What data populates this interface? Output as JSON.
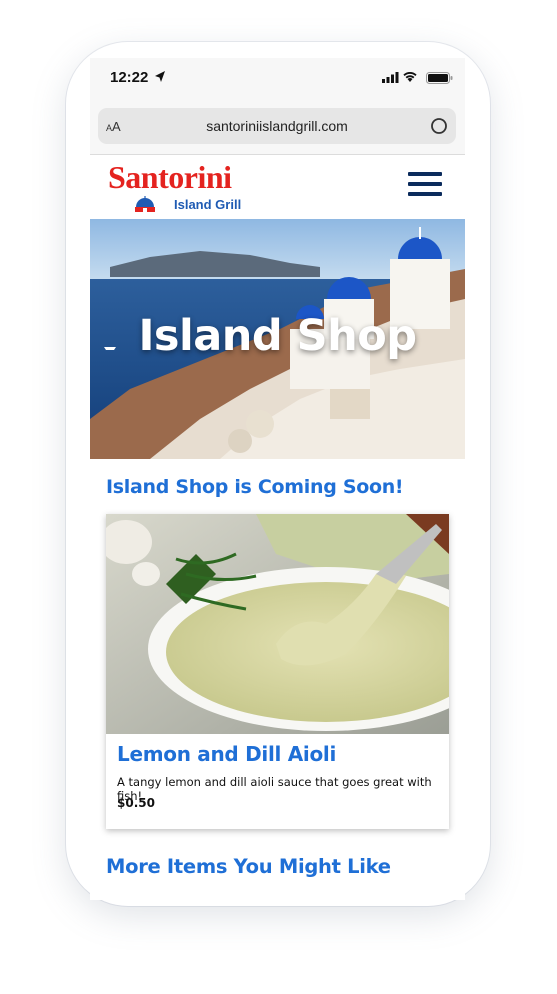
{
  "status_bar": {
    "time": "12:22",
    "icons": [
      "location-arrow-icon",
      "signal-icon",
      "wifi-icon",
      "battery-icon"
    ]
  },
  "browser": {
    "text_size_label": "AA",
    "url": "santoriniislandgrill.com",
    "reload_icon": "reload-icon"
  },
  "site": {
    "logo_word": "Santorini",
    "logo_sub": "Island Grill",
    "menu_icon": "hamburger-menu-icon"
  },
  "hero": {
    "title": "Island Shop"
  },
  "main": {
    "heading": "Island Shop is Coming Soon!",
    "product": {
      "name": "Lemon and Dill Aioli",
      "description": "A tangy lemon and dill aioli sauce that goes great with fish!",
      "price": "$0.50"
    },
    "more_heading": "More Items You Might Like"
  },
  "colors": {
    "brand_red": "#e4231f",
    "brand_blue": "#1f6fd6",
    "navy": "#0b2b5c"
  }
}
